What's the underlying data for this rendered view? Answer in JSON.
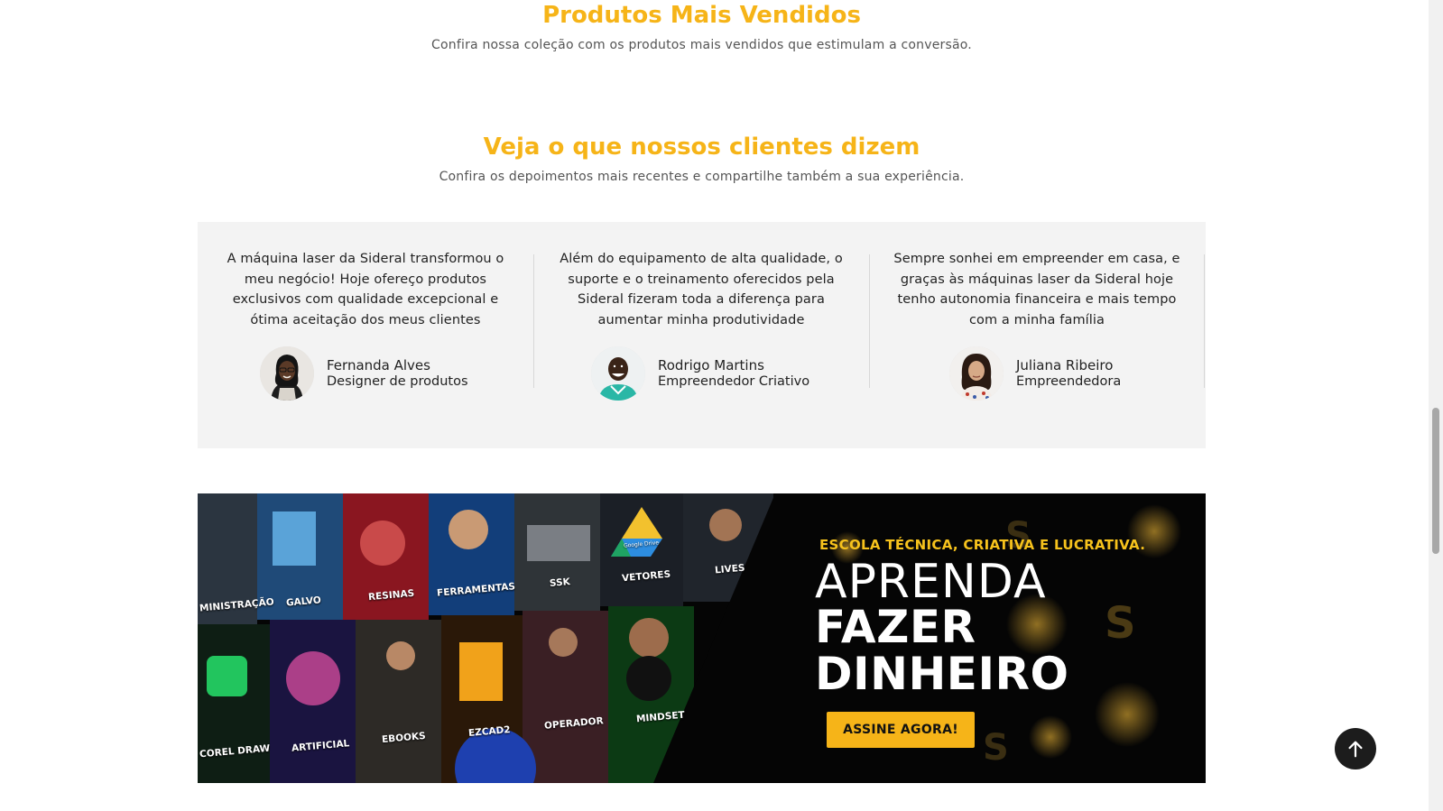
{
  "best_sellers": {
    "title": "Produtos Mais Vendidos",
    "subtitle": "Confira nossa coleção com os produtos mais vendidos que estimulam a conversão."
  },
  "testimonials": {
    "title": "Veja o que nossos clientes dizem",
    "subtitle": "Confira os depoimentos mais recentes e compartilhe também a sua experiência.",
    "items": [
      {
        "quote": "A máquina laser da Sideral transformou o meu negócio! Hoje ofereço produtos exclusivos com qualidade excepcional e ótima aceitação dos meus clientes",
        "name": "Fernanda Alves",
        "role": "Designer de produtos"
      },
      {
        "quote": "Além do equipamento de alta qualidade, o suporte e o treinamento oferecidos pela Sideral fizeram toda a diferença para aumentar minha produtividade",
        "name": "Rodrigo Martins",
        "role": "Empreendedor Criativo"
      },
      {
        "quote": "Sempre sonhei em empreender em casa, e graças às máquinas laser da Sideral hoje tenho autonomia financeira e mais tempo com a minha família",
        "name": "Juliana Ribeiro",
        "role": "Empreendedora"
      }
    ]
  },
  "banner": {
    "eyebrow": "ESCOLA TÉCNICA, CRIATIVA E LUCRATIVA.",
    "headline_1": "APRENDA",
    "headline_2": "FAZER",
    "headline_3": "DINHEIRO",
    "cta": "ASSINE AGORA!",
    "tiles_top": [
      "MINISTRAÇÃO",
      "GALVO",
      "RESINAS",
      "FERRAMENTAS",
      "SSK",
      "VETORES",
      "LIVES"
    ],
    "tiles_bottom": [
      "COREL DRAW",
      "ARTIFICIAL",
      "EBOOKS",
      "EZCAD2",
      "OPERADOR",
      "MINDSET"
    ],
    "tile_extra": "Google Drive"
  },
  "colors": {
    "accent": "#f6b418",
    "banner_bg": "#050505",
    "panel_bg": "#f3f3f3"
  },
  "icons": {
    "scroll_top": "arrow-up-icon"
  }
}
